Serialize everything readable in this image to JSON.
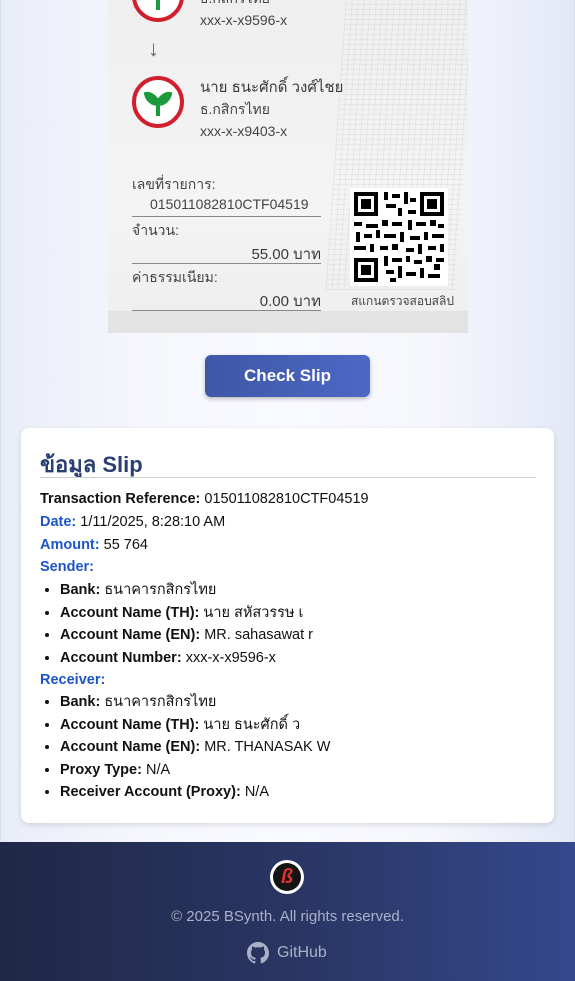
{
  "slip": {
    "sender_bank_partial": "ธ.กสิกรไทย",
    "sender_account": "xxx-x-x9596-x",
    "receiver_name": "นาย ธนะศักดิ์ วงศ์ไชย",
    "receiver_bank": "ธ.กสิกรไทย",
    "receiver_account": "xxx-x-x9403-x",
    "ref_label": "เลขที่รายการ:",
    "ref_value": "015011082810CTF04519",
    "amount_label": "จำนวน:",
    "amount_value": "55.00 บาท",
    "fee_label": "ค่าธรรมเนียม:",
    "fee_value": "0.00 บาท",
    "qr_label": "สแกนตรวจสอบสลิป"
  },
  "check_button": {
    "label": "Check Slip"
  },
  "info": {
    "title": "ข้อมูล Slip",
    "transaction_reference_label": "Transaction Reference:",
    "transaction_reference_value": "015011082810CTF04519",
    "date_label": "Date:",
    "date_value": "1/11/2025, 8:28:10 AM",
    "amount_label": "Amount:",
    "amount_value": "55 764",
    "sender_label": "Sender:",
    "sender": [
      {
        "label": "Bank:",
        "value": "ธนาคารกสิกรไทย"
      },
      {
        "label": "Account Name (TH):",
        "value": "นาย สหัสวรรษ เ"
      },
      {
        "label": "Account Name (EN):",
        "value": "MR. sahasawat r"
      },
      {
        "label": "Account Number:",
        "value": "xxx-x-x9596-x"
      }
    ],
    "receiver_label": "Receiver:",
    "receiver": [
      {
        "label": "Bank:",
        "value": "ธนาคารกสิกรไทย"
      },
      {
        "label": "Account Name (TH):",
        "value": "นาย ธนะศักดิ์ ว"
      },
      {
        "label": "Account Name (EN):",
        "value": "MR. THANASAK W"
      },
      {
        "label": "Proxy Type:",
        "value": "N/A"
      },
      {
        "label": "Receiver Account (Proxy):",
        "value": "N/A"
      }
    ]
  },
  "footer": {
    "copyright": "© 2025 BSynth. All rights reserved.",
    "github_label": "GitHub"
  }
}
